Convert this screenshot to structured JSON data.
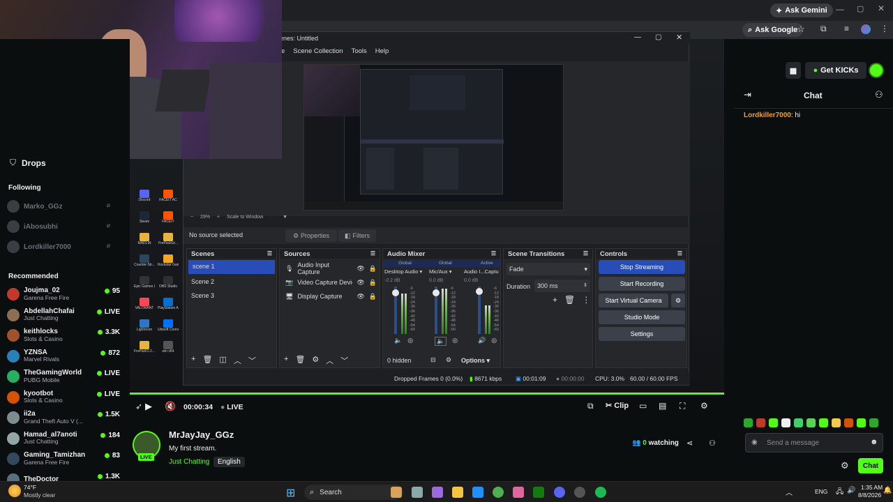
{
  "browser": {
    "ask_gemini": "Ask Gemini",
    "ask_google": "Ask Google"
  },
  "kick": {
    "get_kicks": "Get KICKs"
  },
  "sidebar": {
    "drops": "Drops",
    "following_title": "Following",
    "following": [
      {
        "name": "Marko_GGz"
      },
      {
        "name": "iAbosubhi"
      },
      {
        "name": "Lordkiller7000"
      }
    ],
    "recommended_title": "Recommended",
    "recommended": [
      {
        "name": "Joujma_02",
        "category": "Garena Free Fire",
        "count": "95",
        "color": "#c0392b"
      },
      {
        "name": "AbdellahChafai",
        "category": "Just Chatting",
        "count": "LIVE",
        "color": "#8e6e53"
      },
      {
        "name": "keithlocks",
        "category": "Slots & Casino",
        "count": "3.3K",
        "color": "#a0522d"
      },
      {
        "name": "YZNSA",
        "category": "Marvel Rivals",
        "count": "872",
        "color": "#2980b9"
      },
      {
        "name": "TheGamingWorld",
        "category": "PUBG Mobile",
        "count": "LIVE",
        "color": "#27ae60"
      },
      {
        "name": "kyootbot",
        "category": "Slots & Casino",
        "count": "LIVE",
        "color": "#d35400"
      },
      {
        "name": "ii2a",
        "category": "Grand Theft Auto V (...",
        "count": "1.5K",
        "color": "#7f8c8d"
      },
      {
        "name": "Hamad_al7anoti",
        "category": "Just Chatting",
        "count": "184",
        "color": "#95a5a6"
      },
      {
        "name": "Gaming_Tamizhan",
        "category": "Garena Free Fire",
        "count": "83",
        "color": "#34495e"
      },
      {
        "name": "TheDoctor",
        "category": "",
        "count": "1.3K",
        "color": "#5d6d7e"
      }
    ]
  },
  "obs": {
    "title": "enes: Untitled",
    "menu": [
      "e",
      "Scene Collection",
      "Tools",
      "Help"
    ],
    "zoom": "29%",
    "scale": "Scale to Window",
    "no_source": "No source selected",
    "properties": "Properties",
    "filters": "Filters",
    "scenes_title": "Scenes",
    "scenes": [
      "scene 1",
      "Scene 2",
      "Scene 3"
    ],
    "sources_title": "Sources",
    "sources": [
      "Audio Input Capture",
      "Video Capture Device",
      "Display Capture"
    ],
    "mixer_title": "Audio Mixer",
    "mixer_labels": [
      "Global",
      "Global",
      "Active"
    ],
    "mixer_channels": [
      "Desktop Audio",
      "Mic/Aux",
      "Audio I...Captu"
    ],
    "mixer_db": [
      "-2.2 dB",
      "0.0 dB",
      "0.0 dB"
    ],
    "meter_ticks": [
      "-6",
      "-12",
      "-18",
      "-24",
      "-30",
      "-36",
      "-42",
      "-48",
      "-54",
      "-60"
    ],
    "hidden": "0 hidden",
    "options": "Options",
    "transitions_title": "Scene Transitions",
    "transition": "Fade",
    "duration_label": "Duration",
    "duration": "300 ms",
    "controls_title": "Controls",
    "stop_streaming": "Stop Streaming",
    "start_recording": "Start Recording",
    "start_virtual_camera": "Start Virtual Camera",
    "studio_mode": "Studio Mode",
    "settings": "Settings",
    "dropped_frames": "Dropped Frames 0 (0.0%)",
    "kbps": "8671 kbps",
    "stream_time": "00:01:09",
    "rec_time": "00:00:00",
    "cpu": "CPU: 3.0%",
    "fps": "60.00 / 60.00 FPS"
  },
  "desktop_icons": [
    "Discord",
    "FACEIT AC",
    "Steam",
    "FACEIT",
    "MADLIN",
    "FrePackGr...",
    "Counter-Str...",
    "Rockstar Games...",
    "Epic Games Launcher",
    "OBS Studio",
    "VALORANT",
    "PlayStation Accessories",
    "Lightroom",
    "Ubisoft Connect",
    "FroPack1-2...",
    "win x64"
  ],
  "player": {
    "time": "00:00:34",
    "live": "LIVE",
    "clip": "Clip"
  },
  "stream": {
    "streamer": "MrJayJay_GGz",
    "title": "My first stream.",
    "category": "Just Chatting",
    "language": "English",
    "watching_count": "0",
    "watching_label": "watching",
    "avatar_badge": "LIVE"
  },
  "chat": {
    "title": "Chat",
    "messages": [
      {
        "user": "Lordkiller7000",
        "text": ": hi",
        "color": "#ff9f1c"
      }
    ],
    "placeholder": "Send a message",
    "send": "Chat"
  },
  "taskbar": {
    "weather_temp": "74°F",
    "weather_desc": "Mostly clear",
    "search": "Search",
    "lang": "ENG",
    "time": "1:35 AM",
    "date": "8/8/2026"
  },
  "colors": {
    "kick_green": "#53fc18",
    "obs_blue": "#284cb8"
  }
}
